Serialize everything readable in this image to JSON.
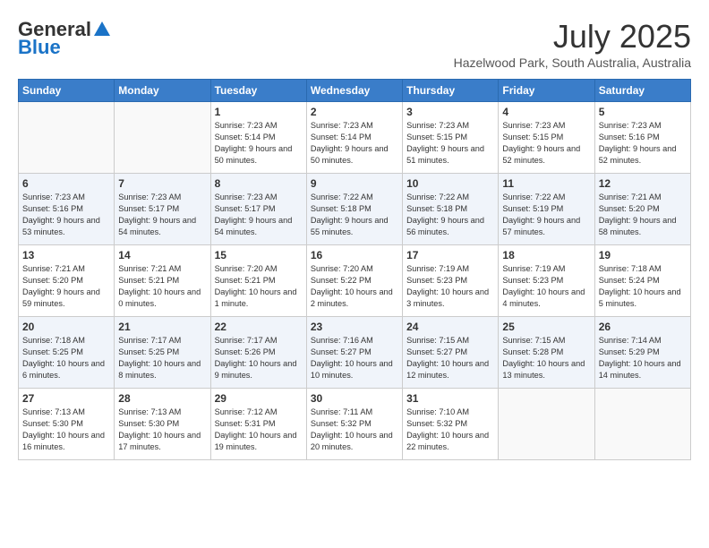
{
  "header": {
    "logo_general": "General",
    "logo_blue": "Blue",
    "month_year": "July 2025",
    "location": "Hazelwood Park, South Australia, Australia"
  },
  "weekdays": [
    "Sunday",
    "Monday",
    "Tuesday",
    "Wednesday",
    "Thursday",
    "Friday",
    "Saturday"
  ],
  "weeks": [
    [
      {
        "day": "",
        "sunrise": "",
        "sunset": "",
        "daylight": ""
      },
      {
        "day": "",
        "sunrise": "",
        "sunset": "",
        "daylight": ""
      },
      {
        "day": "1",
        "sunrise": "Sunrise: 7:23 AM",
        "sunset": "Sunset: 5:14 PM",
        "daylight": "Daylight: 9 hours and 50 minutes."
      },
      {
        "day": "2",
        "sunrise": "Sunrise: 7:23 AM",
        "sunset": "Sunset: 5:14 PM",
        "daylight": "Daylight: 9 hours and 50 minutes."
      },
      {
        "day": "3",
        "sunrise": "Sunrise: 7:23 AM",
        "sunset": "Sunset: 5:15 PM",
        "daylight": "Daylight: 9 hours and 51 minutes."
      },
      {
        "day": "4",
        "sunrise": "Sunrise: 7:23 AM",
        "sunset": "Sunset: 5:15 PM",
        "daylight": "Daylight: 9 hours and 52 minutes."
      },
      {
        "day": "5",
        "sunrise": "Sunrise: 7:23 AM",
        "sunset": "Sunset: 5:16 PM",
        "daylight": "Daylight: 9 hours and 52 minutes."
      }
    ],
    [
      {
        "day": "6",
        "sunrise": "Sunrise: 7:23 AM",
        "sunset": "Sunset: 5:16 PM",
        "daylight": "Daylight: 9 hours and 53 minutes."
      },
      {
        "day": "7",
        "sunrise": "Sunrise: 7:23 AM",
        "sunset": "Sunset: 5:17 PM",
        "daylight": "Daylight: 9 hours and 54 minutes."
      },
      {
        "day": "8",
        "sunrise": "Sunrise: 7:23 AM",
        "sunset": "Sunset: 5:17 PM",
        "daylight": "Daylight: 9 hours and 54 minutes."
      },
      {
        "day": "9",
        "sunrise": "Sunrise: 7:22 AM",
        "sunset": "Sunset: 5:18 PM",
        "daylight": "Daylight: 9 hours and 55 minutes."
      },
      {
        "day": "10",
        "sunrise": "Sunrise: 7:22 AM",
        "sunset": "Sunset: 5:18 PM",
        "daylight": "Daylight: 9 hours and 56 minutes."
      },
      {
        "day": "11",
        "sunrise": "Sunrise: 7:22 AM",
        "sunset": "Sunset: 5:19 PM",
        "daylight": "Daylight: 9 hours and 57 minutes."
      },
      {
        "day": "12",
        "sunrise": "Sunrise: 7:21 AM",
        "sunset": "Sunset: 5:20 PM",
        "daylight": "Daylight: 9 hours and 58 minutes."
      }
    ],
    [
      {
        "day": "13",
        "sunrise": "Sunrise: 7:21 AM",
        "sunset": "Sunset: 5:20 PM",
        "daylight": "Daylight: 9 hours and 59 minutes."
      },
      {
        "day": "14",
        "sunrise": "Sunrise: 7:21 AM",
        "sunset": "Sunset: 5:21 PM",
        "daylight": "Daylight: 10 hours and 0 minutes."
      },
      {
        "day": "15",
        "sunrise": "Sunrise: 7:20 AM",
        "sunset": "Sunset: 5:21 PM",
        "daylight": "Daylight: 10 hours and 1 minute."
      },
      {
        "day": "16",
        "sunrise": "Sunrise: 7:20 AM",
        "sunset": "Sunset: 5:22 PM",
        "daylight": "Daylight: 10 hours and 2 minutes."
      },
      {
        "day": "17",
        "sunrise": "Sunrise: 7:19 AM",
        "sunset": "Sunset: 5:23 PM",
        "daylight": "Daylight: 10 hours and 3 minutes."
      },
      {
        "day": "18",
        "sunrise": "Sunrise: 7:19 AM",
        "sunset": "Sunset: 5:23 PM",
        "daylight": "Daylight: 10 hours and 4 minutes."
      },
      {
        "day": "19",
        "sunrise": "Sunrise: 7:18 AM",
        "sunset": "Sunset: 5:24 PM",
        "daylight": "Daylight: 10 hours and 5 minutes."
      }
    ],
    [
      {
        "day": "20",
        "sunrise": "Sunrise: 7:18 AM",
        "sunset": "Sunset: 5:25 PM",
        "daylight": "Daylight: 10 hours and 6 minutes."
      },
      {
        "day": "21",
        "sunrise": "Sunrise: 7:17 AM",
        "sunset": "Sunset: 5:25 PM",
        "daylight": "Daylight: 10 hours and 8 minutes."
      },
      {
        "day": "22",
        "sunrise": "Sunrise: 7:17 AM",
        "sunset": "Sunset: 5:26 PM",
        "daylight": "Daylight: 10 hours and 9 minutes."
      },
      {
        "day": "23",
        "sunrise": "Sunrise: 7:16 AM",
        "sunset": "Sunset: 5:27 PM",
        "daylight": "Daylight: 10 hours and 10 minutes."
      },
      {
        "day": "24",
        "sunrise": "Sunrise: 7:15 AM",
        "sunset": "Sunset: 5:27 PM",
        "daylight": "Daylight: 10 hours and 12 minutes."
      },
      {
        "day": "25",
        "sunrise": "Sunrise: 7:15 AM",
        "sunset": "Sunset: 5:28 PM",
        "daylight": "Daylight: 10 hours and 13 minutes."
      },
      {
        "day": "26",
        "sunrise": "Sunrise: 7:14 AM",
        "sunset": "Sunset: 5:29 PM",
        "daylight": "Daylight: 10 hours and 14 minutes."
      }
    ],
    [
      {
        "day": "27",
        "sunrise": "Sunrise: 7:13 AM",
        "sunset": "Sunset: 5:30 PM",
        "daylight": "Daylight: 10 hours and 16 minutes."
      },
      {
        "day": "28",
        "sunrise": "Sunrise: 7:13 AM",
        "sunset": "Sunset: 5:30 PM",
        "daylight": "Daylight: 10 hours and 17 minutes."
      },
      {
        "day": "29",
        "sunrise": "Sunrise: 7:12 AM",
        "sunset": "Sunset: 5:31 PM",
        "daylight": "Daylight: 10 hours and 19 minutes."
      },
      {
        "day": "30",
        "sunrise": "Sunrise: 7:11 AM",
        "sunset": "Sunset: 5:32 PM",
        "daylight": "Daylight: 10 hours and 20 minutes."
      },
      {
        "day": "31",
        "sunrise": "Sunrise: 7:10 AM",
        "sunset": "Sunset: 5:32 PM",
        "daylight": "Daylight: 10 hours and 22 minutes."
      },
      {
        "day": "",
        "sunrise": "",
        "sunset": "",
        "daylight": ""
      },
      {
        "day": "",
        "sunrise": "",
        "sunset": "",
        "daylight": ""
      }
    ]
  ]
}
